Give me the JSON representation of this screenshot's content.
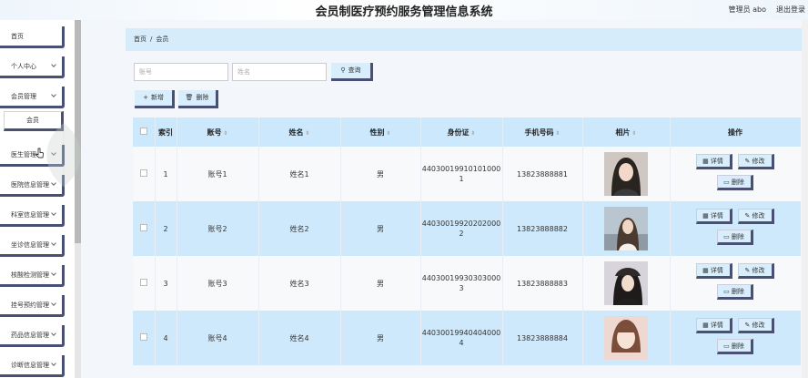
{
  "app": {
    "title": "会员制医疗预约服务管理信息系统",
    "admin": "管理员 abo",
    "logout": "退出登录"
  },
  "sidebar": {
    "home": "首页",
    "items": [
      "个人中心",
      "会员管理",
      "医生管理",
      "医院信息管理",
      "科室信息管理",
      "坐诊信息管理",
      "核酸检测管理",
      "挂号预约管理",
      "药品信息管理",
      "诊断信息管理"
    ],
    "sub_member": "会员"
  },
  "breadcrumb": {
    "home": "首页",
    "sep": "/",
    "current": "会员"
  },
  "search": {
    "account_placeholder": "账号",
    "name_placeholder": "姓名",
    "query_label": "查询"
  },
  "actions": {
    "add_label": "新增",
    "delete_label": "删除"
  },
  "table": {
    "headers": [
      "索引",
      "账号",
      "姓名",
      "性别",
      "身份证",
      "手机号码",
      "相片",
      "操作"
    ],
    "rows": [
      {
        "index": "1",
        "account": "账号1",
        "name": "姓名1",
        "gender": "男",
        "id_card": "440300199101010001",
        "phone": "13823888881"
      },
      {
        "index": "2",
        "account": "账号2",
        "name": "姓名2",
        "gender": "男",
        "id_card": "440300199202020002",
        "phone": "13823888882"
      },
      {
        "index": "3",
        "account": "账号3",
        "name": "姓名3",
        "gender": "男",
        "id_card": "440300199303030003",
        "phone": "13823888883"
      },
      {
        "index": "4",
        "account": "账号4",
        "name": "姓名4",
        "gender": "男",
        "id_card": "440300199404040004",
        "phone": "13823888884"
      }
    ],
    "ops": {
      "detail": "详情",
      "edit": "修改",
      "delete": "删除"
    }
  }
}
